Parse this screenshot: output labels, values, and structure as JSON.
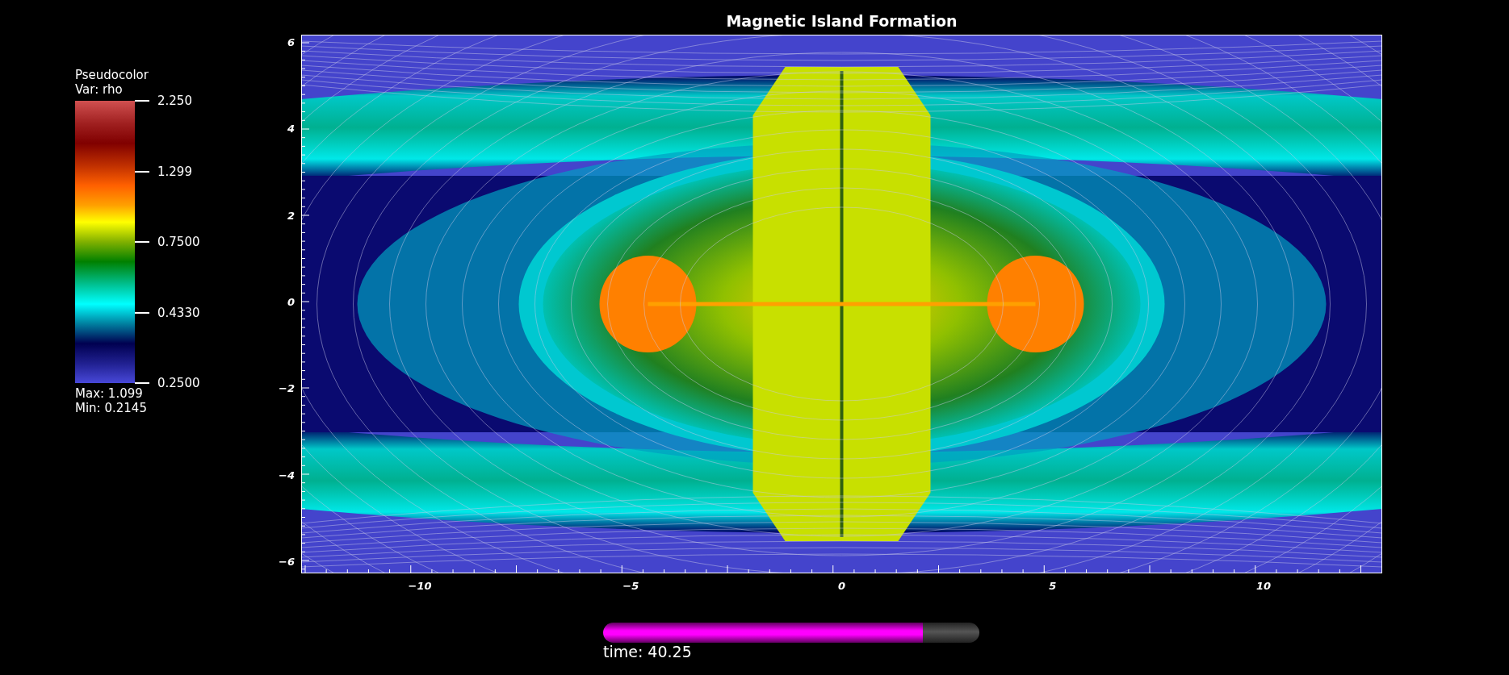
{
  "title": "Magnetic Island Formation",
  "legend": {
    "plot_type": "Pseudocolor",
    "variable": "Var: rho",
    "ticks": [
      "2.250",
      "1.299",
      "0.7500",
      "0.4330",
      "0.2500"
    ],
    "max": "Max:  1.099",
    "min": "Min:  0.2145"
  },
  "axes": {
    "y_ticks": [
      "6",
      "4",
      "2",
      "0",
      "−2",
      "−4",
      "−6"
    ],
    "x_ticks": [
      "−10",
      "−5",
      "0",
      "5",
      "10"
    ]
  },
  "time_slider": {
    "level": 0.85,
    "label": "time: 40.25"
  }
}
